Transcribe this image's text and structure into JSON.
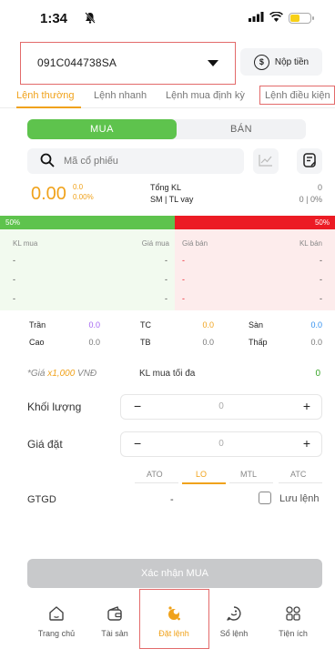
{
  "status": {
    "time": "1:34"
  },
  "account": {
    "id": "091C044738SA",
    "deposit_label": "Nộp tiền"
  },
  "tabs": [
    {
      "label": "Lệnh thường"
    },
    {
      "label": "Lệnh nhanh"
    },
    {
      "label": "Lệnh mua định kỳ"
    },
    {
      "label": "Lệnh điều kiện"
    }
  ],
  "side": {
    "buy": "MUA",
    "sell": "BÁN"
  },
  "search": {
    "placeholder": "Mã cổ phiếu"
  },
  "quote": {
    "price": "0.00",
    "change": "0.0",
    "change_pct": "0.00%",
    "total_vol_label": "Tổng KL",
    "total_vol_value": "0",
    "sm_label": "SM | TL vay",
    "sm_value": "0 | 0%"
  },
  "ratio": {
    "buy": "50%",
    "sell": "50%",
    "buy_fraction": 0.5
  },
  "orderbook": {
    "headers": {
      "buy_vol": "KL mua",
      "buy_price": "Giá mua",
      "sell_price": "Giá bán",
      "sell_vol": "KL bán"
    },
    "empty": "-"
  },
  "stats": {
    "ceiling_label": "Trần",
    "ceiling": "0.0",
    "ref_label": "TC",
    "ref": "0.0",
    "floor_label": "Sàn",
    "floor": "0.0",
    "high_label": "Cao",
    "high": "0.0",
    "avg_label": "TB",
    "avg": "0.0",
    "low_label": "Thấp",
    "low": "0.0"
  },
  "note": {
    "prefix": "*Giá ",
    "multiplier": "x1,000",
    "suffix": " VNĐ",
    "max_buy_label": "KL mua tối đa",
    "max_buy": "0"
  },
  "form": {
    "qty_label": "Khối lượng",
    "qty_value": "0",
    "price_label": "Giá đặt",
    "price_value": "0",
    "minus": "−",
    "plus": "+"
  },
  "order_types": [
    "ATO",
    "LO",
    "MTL",
    "ATC"
  ],
  "gtgd": {
    "label": "GTGD",
    "value": "-",
    "save_label": "Lưu lệnh"
  },
  "confirm_label": "Xác nhận MUA",
  "nav": [
    {
      "label": "Trang chủ"
    },
    {
      "label": "Tài sản"
    },
    {
      "label": "Đặt lệnh"
    },
    {
      "label": "Sổ lệnh"
    },
    {
      "label": "Tiện ích"
    }
  ],
  "colors": {
    "accent": "#f0a21b",
    "buy": "#5ec34d",
    "sell": "#ec1b24",
    "ceiling": "#a463f2",
    "floor": "#2f8ff0"
  }
}
